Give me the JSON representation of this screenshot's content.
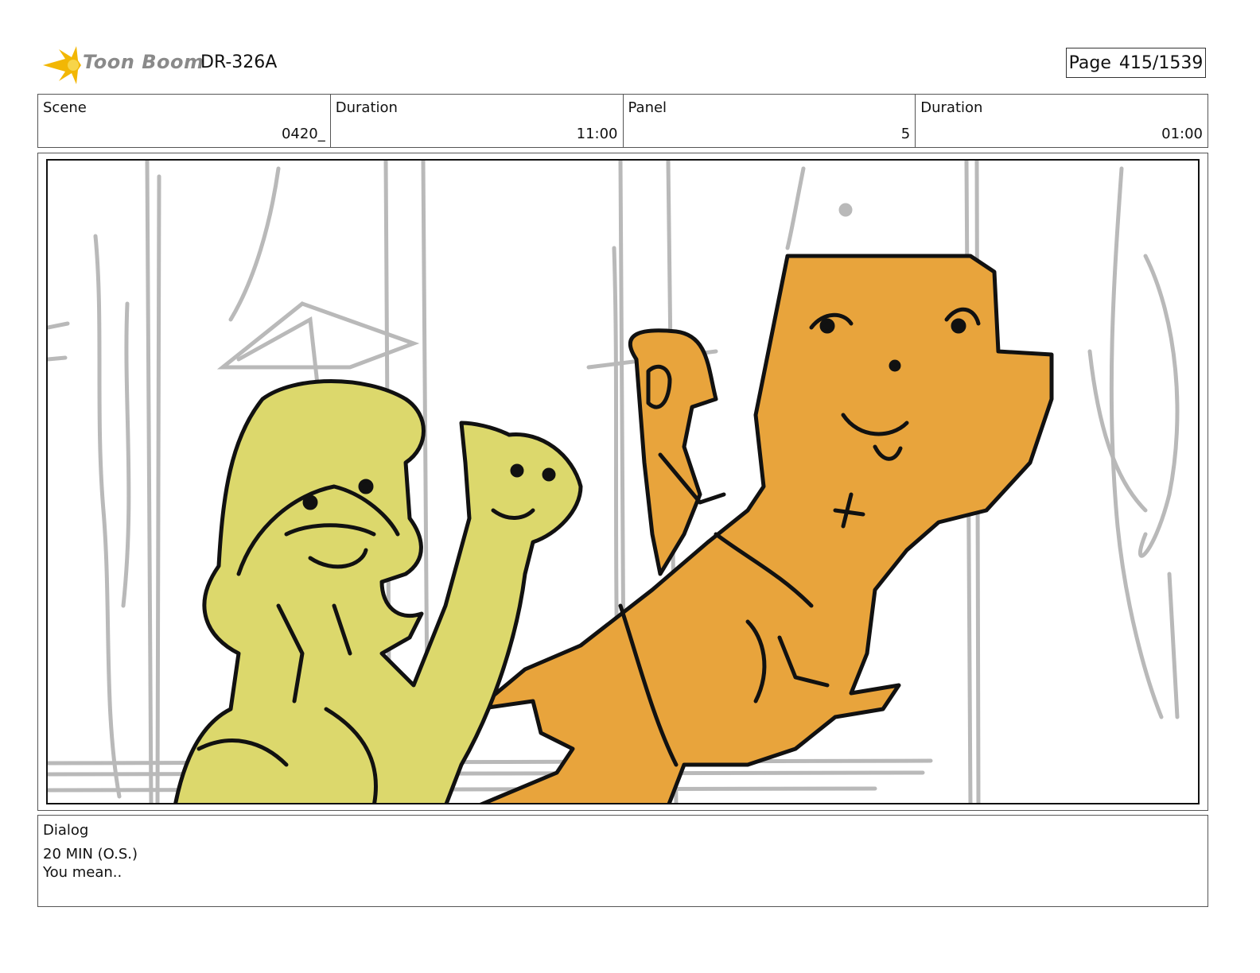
{
  "header": {
    "logo_text": "Toon Boom",
    "production_code": "DR-326A",
    "page_label": "Page",
    "page_value": "415/1539"
  },
  "info": {
    "scene_label": "Scene",
    "scene_value": "0420_",
    "scene_duration_label": "Duration",
    "scene_duration_value": "11:00",
    "panel_label": "Panel",
    "panel_value": "5",
    "panel_duration_label": "Duration",
    "panel_duration_value": "01:00"
  },
  "dialog": {
    "label": "Dialog",
    "speaker": "20 MIN (O.S.)",
    "line": "You mean.."
  },
  "colors": {
    "yellow_fill": "#dcd86c",
    "orange_fill": "#e8a43c",
    "sketch_gray": "#b9b9b9",
    "ink": "#111111"
  }
}
